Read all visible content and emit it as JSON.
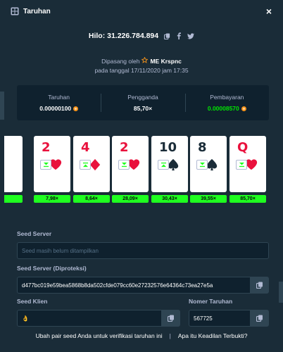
{
  "modal": {
    "title": "Taruhan",
    "close_label": "×"
  },
  "bet": {
    "hilo_label": "Hilo: 31.226.784.894",
    "placed_by_prefix": "Dipasang oleh",
    "user": "ME Krspnc",
    "date": "pada tanggal 17/11/2020 jam 17:35"
  },
  "stats": [
    {
      "label": "Taruhan",
      "value": "0.00000100",
      "color": "#ffffff"
    },
    {
      "label": "Pengganda",
      "value": "85,70×",
      "color": "#ffffff"
    },
    {
      "label": "Pembayaran",
      "value": "0.00008570",
      "color": "#00e701"
    }
  ],
  "cards": [
    {
      "rank": "",
      "suit": "",
      "color": "red",
      "action": "lower",
      "multiplier": ""
    },
    {
      "rank": "2",
      "suit": "heart",
      "color": "red",
      "action": "lower",
      "multiplier": "7,98×"
    },
    {
      "rank": "4",
      "suit": "diamond",
      "color": "red",
      "action": "higher",
      "multiplier": "8,64×"
    },
    {
      "rank": "2",
      "suit": "heart",
      "color": "red",
      "action": "lower",
      "multiplier": "28,09×"
    },
    {
      "rank": "10",
      "suit": "spade",
      "color": "black",
      "action": "higher",
      "multiplier": "30,43×"
    },
    {
      "rank": "8",
      "suit": "spade",
      "color": "black",
      "action": "lower",
      "multiplier": "39,55×"
    },
    {
      "rank": "Q",
      "suit": "heart",
      "color": "red",
      "action": "lower",
      "multiplier": "85,70×"
    }
  ],
  "seeds": {
    "server_label": "Seed Server",
    "server_placeholder": "Seed masih belum ditampilkan",
    "hashed_label": "Seed Server (Diproteksi)",
    "hashed_value": "d477bc019e59bea5868b8da502cfde079cc60e27232576e64364c73ea27e5a",
    "client_label": "Seed Klien",
    "client_value": "👌",
    "nonce_label": "Nomer Taruhan",
    "nonce_value": "567725"
  },
  "footer": {
    "change_seed_link": "Ubah pair seed Anda untuk verifikasi taruhan ini",
    "separator": "|",
    "fairness_link": "Apa itu Keadilan Terbukti?"
  },
  "colors": {
    "bg": "#1a2c38",
    "panel": "#0f212e",
    "accent_green": "#00e701",
    "multiplier_green": "#1fff20",
    "card_red": "#e9113c"
  }
}
